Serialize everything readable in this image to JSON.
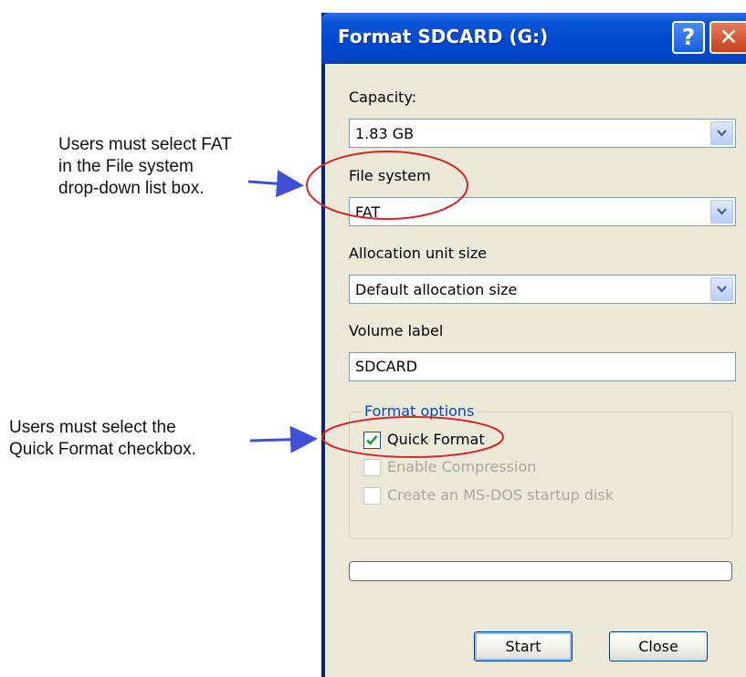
{
  "annotations": {
    "fat_note": [
      "Users must select FAT",
      "in the File system",
      "drop-down list box."
    ],
    "quick_note": [
      "Users must select the",
      "Quick Format checkbox."
    ],
    "arrow_color": "#3f4fd6",
    "highlight_color": "#d6262a"
  },
  "window": {
    "title": "Format SDCARD (G:)",
    "help_glyph": "?",
    "close_glyph": "✕"
  },
  "form": {
    "capacity": {
      "label": "Capacity:",
      "value": "1.83 GB"
    },
    "file_system": {
      "label": "File system",
      "value": "FAT"
    },
    "allocation": {
      "label": "Allocation unit size",
      "value": "Default allocation size"
    },
    "volume": {
      "label": "Volume label",
      "value": "SDCARD"
    },
    "options": {
      "title": "Format options",
      "quick_format": {
        "label": "Quick Format",
        "checked": true,
        "enabled": true
      },
      "enable_compression": {
        "label": "Enable Compression",
        "checked": false,
        "enabled": false
      },
      "msdos_startup": {
        "label": "Create an MS-DOS startup disk",
        "checked": false,
        "enabled": false
      }
    },
    "progress": 0
  },
  "buttons": {
    "start": "Start",
    "close": "Close"
  },
  "colors": {
    "title_bar": "#0049cf",
    "dialog_bg": "#ece9d8",
    "group_title": "#0046d5"
  }
}
